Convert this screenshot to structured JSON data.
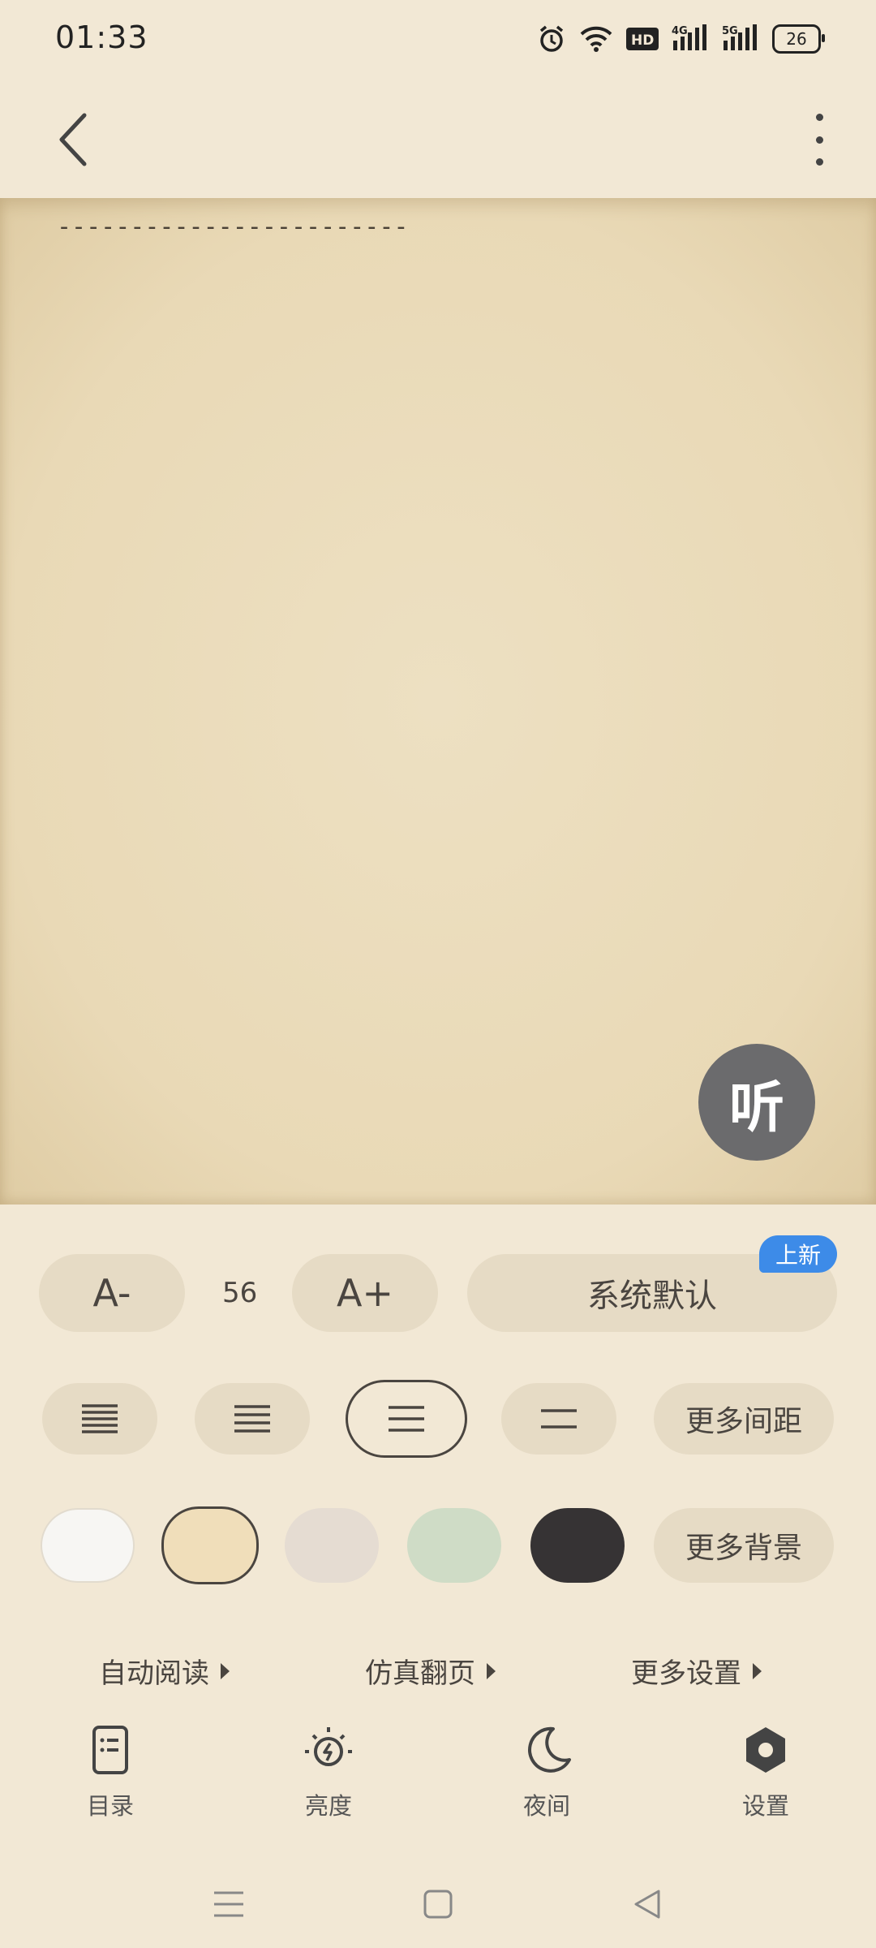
{
  "status_bar": {
    "time": "01:33",
    "battery": "26",
    "icons": [
      "alarm-icon",
      "wifi-icon",
      "hd-icon",
      "signal-4g-icon",
      "signal-5g-icon",
      "battery-icon"
    ]
  },
  "top_bar": {
    "back_icon": "chevron-left-icon",
    "more_icon": "more-vertical-icon"
  },
  "page": {
    "text_line": "------------------------",
    "listen_label": "听",
    "background_color": "#ebddbc"
  },
  "settings_panel": {
    "font_decrease_label": "A-",
    "font_size_value": "56",
    "font_increase_label": "A+",
    "font_family_label": "系统默认",
    "font_family_badge": "上新",
    "spacing_options": [
      {
        "name": "spacing-compact",
        "lines": 5,
        "selected": false
      },
      {
        "name": "spacing-normal",
        "lines": 4,
        "selected": false
      },
      {
        "name": "spacing-loose",
        "lines": 3,
        "selected": true
      },
      {
        "name": "spacing-wide",
        "lines": 2,
        "selected": false
      }
    ],
    "more_spacing_label": "更多间距",
    "background_options": [
      {
        "name": "bg-white",
        "color": "#f7f6f3",
        "selected": false
      },
      {
        "name": "bg-parchment",
        "color": "#f0deba",
        "selected": true
      },
      {
        "name": "bg-gray",
        "color": "#e5dcd2",
        "selected": false
      },
      {
        "name": "bg-green",
        "color": "#cfdcc6",
        "selected": false
      },
      {
        "name": "bg-dark",
        "color": "#363334",
        "selected": false
      }
    ],
    "more_background_label": "更多背景",
    "quick_links": [
      "自动阅读",
      "仿真翻页",
      "更多设置"
    ]
  },
  "bottom_tabs": [
    {
      "icon": "catalog-icon",
      "label": "目录"
    },
    {
      "icon": "brightness-icon",
      "label": "亮度"
    },
    {
      "icon": "moon-icon",
      "label": "夜间"
    },
    {
      "icon": "settings-hex-icon",
      "label": "设置"
    }
  ],
  "nav_bar": {
    "icons": [
      "menu-icon",
      "home-square-icon",
      "back-triangle-icon"
    ]
  }
}
